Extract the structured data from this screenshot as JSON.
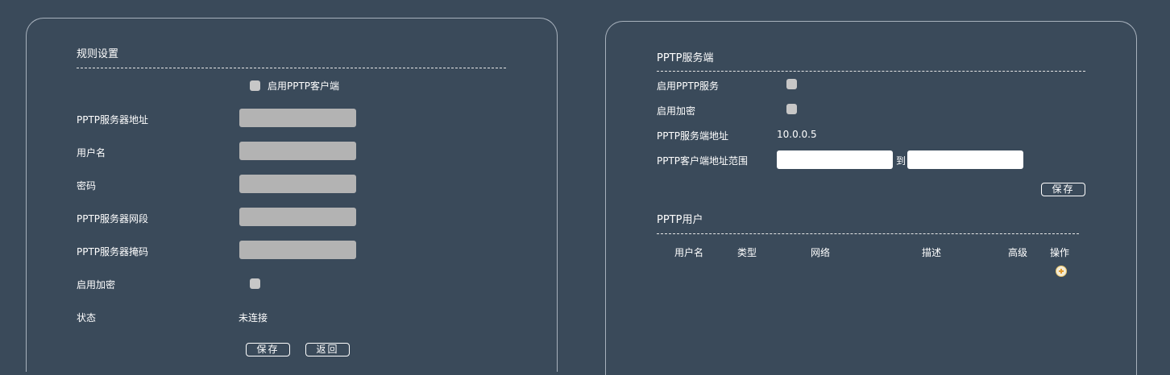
{
  "left_panel": {
    "title": "规则设置",
    "enable_client_label": "启用PPTP客户端",
    "rows": [
      {
        "label": "PPTP服务器地址",
        "value": ""
      },
      {
        "label": "用户名",
        "value": ""
      },
      {
        "label": "密码",
        "value": ""
      },
      {
        "label": "PPTP服务器网段",
        "value": ""
      },
      {
        "label": "PPTP服务器掩码",
        "value": ""
      }
    ],
    "encryption_label": "启用加密",
    "status_label": "状态",
    "status_value": "未连接",
    "save_label": "保存",
    "back_label": "返回"
  },
  "right_panel": {
    "server_title": "PPTP服务端",
    "enable_service_label": "启用PPTP服务",
    "encryption_label": "启用加密",
    "server_address_label": "PPTP服务端地址",
    "server_address_value": "10.0.0.5",
    "client_range_label": "PPTP客户端地址范围",
    "range_to": "到",
    "range_start": "",
    "range_end": "",
    "save_label": "保存",
    "users_title": "PPTP用户",
    "table_headers": [
      "用户名",
      "类型",
      "网络",
      "描述",
      "高级",
      "操作"
    ],
    "add_icon": "add-icon"
  },
  "colors": {
    "background": "#3a4a5a",
    "input_gray": "#b3b3b3",
    "checkbox": "#c7c7c7"
  }
}
